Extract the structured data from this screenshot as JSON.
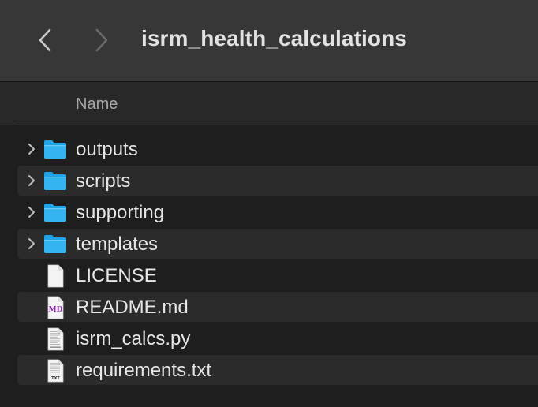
{
  "window": {
    "title": "isrm_health_calculations"
  },
  "toolbar": {
    "back_icon": "chevron-left-icon",
    "forward_icon": "chevron-right-icon"
  },
  "columns": {
    "name": "Name"
  },
  "colors": {
    "folder": "#1fa4ea",
    "toolbar_bg": "#373737",
    "list_bg": "#1e1e1e",
    "alt_row_bg": "#2b2b2b",
    "text": "#e6e6e6",
    "markdown_badge": "#8a2aa8"
  },
  "files": [
    {
      "name": "outputs",
      "kind": "folder",
      "icon": "folder-icon",
      "expandable": true
    },
    {
      "name": "scripts",
      "kind": "folder",
      "icon": "folder-icon",
      "expandable": true
    },
    {
      "name": "supporting",
      "kind": "folder",
      "icon": "folder-icon",
      "expandable": true
    },
    {
      "name": "templates",
      "kind": "folder",
      "icon": "folder-icon",
      "expandable": true
    },
    {
      "name": "LICENSE",
      "kind": "file",
      "icon": "blank-document-icon",
      "expandable": false
    },
    {
      "name": "README.md",
      "kind": "markdown",
      "icon": "markdown-document-icon",
      "badge": "MD",
      "expandable": false
    },
    {
      "name": "isrm_calcs.py",
      "kind": "python",
      "icon": "python-document-icon",
      "expandable": false
    },
    {
      "name": "requirements.txt",
      "kind": "text",
      "icon": "text-document-icon",
      "badge": "TXT",
      "expandable": false
    }
  ]
}
